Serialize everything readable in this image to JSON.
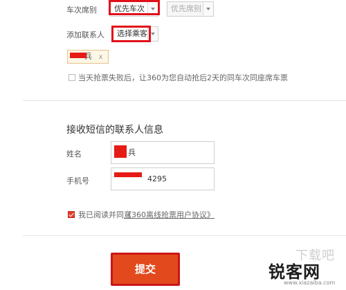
{
  "seat": {
    "label": "车次席别",
    "primary_value": "优先车次",
    "secondary_value": "优先席别"
  },
  "contact": {
    "label": "添加联系人",
    "select_value": "选择乘客",
    "tag_text": "兵",
    "tag_close": "x"
  },
  "auto_grab": {
    "text": "当天抢票失败后，让360为您自动抢后2天的同车次同座席车票",
    "checked": false
  },
  "sms": {
    "heading": "接收短信的联系人信息",
    "name_label": "姓名",
    "name_value": "兵",
    "phone_label": "手机号",
    "phone_value": "4295"
  },
  "agreement": {
    "prefix": "我已阅读并同意",
    "link": "《360离线抢票用户协议》",
    "checked": true
  },
  "submit_label": "提交",
  "watermark": {
    "big": "锐客网",
    "top": "下载吧",
    "url": "www.xiazaiba.com"
  },
  "colors": {
    "accent": "#e24a1e",
    "redact": "#e51b16"
  }
}
